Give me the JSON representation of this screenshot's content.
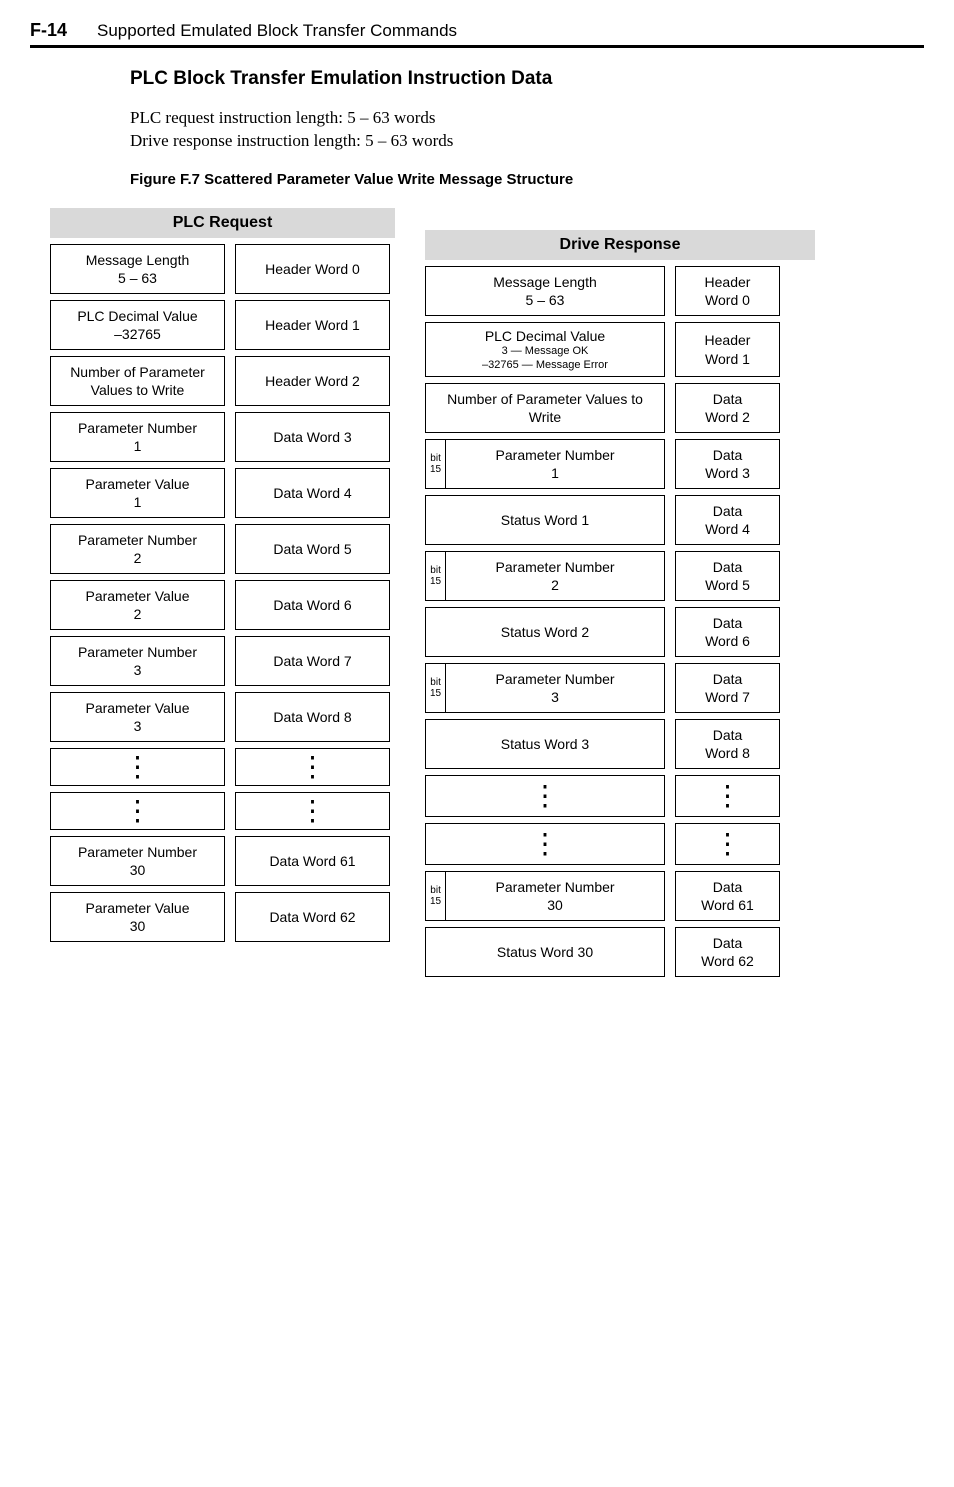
{
  "page": {
    "number": "F-14",
    "header": "Supported Emulated Block Transfer Commands"
  },
  "section_title": "PLC Block Transfer Emulation Instruction Data",
  "body1": "PLC request instruction length: 5 – 63 words",
  "body2": "Drive response instruction length: 5 – 63 words",
  "figure_label": "Figure F.7   Scattered Parameter Value Write Message Structure",
  "plc_request": {
    "title": "PLC Request",
    "left": [
      "Message Length\n5 – 63",
      "PLC Decimal Value\n–32765",
      "Number of Parameter Values to Write",
      "Parameter Number\n1",
      "Parameter Value\n1",
      "Parameter Number\n2",
      "Parameter Value\n2",
      "Parameter Number\n3",
      "Parameter Value\n3",
      "⋮",
      "⋮",
      "Parameter Number\n30",
      "Parameter Value\n30"
    ],
    "right": [
      "Header Word 0",
      "Header Word 1",
      "Header Word 2",
      "Data Word 3",
      "Data Word 4",
      "Data Word 5",
      "Data Word 6",
      "Data Word 7",
      "Data Word 8",
      "⋮",
      "⋮",
      "Data Word 61",
      "Data Word 62"
    ]
  },
  "drive_response": {
    "title": "Drive Response",
    "bit_label_top": "bit",
    "bit_label_bot": "15",
    "left": [
      {
        "text": "Message Length\n5 – 63"
      },
      {
        "text": "PLC Decimal Value",
        "sub": "3 — Message OK\n–32765 — Message Error"
      },
      {
        "text": "Number of Parameter Values to Write"
      },
      {
        "bit": true,
        "text": "Parameter Number\n1"
      },
      {
        "text": "Status Word 1"
      },
      {
        "bit": true,
        "text": "Parameter Number\n2"
      },
      {
        "text": "Status Word 2"
      },
      {
        "bit": true,
        "text": "Parameter Number\n3"
      },
      {
        "text": "Status Word 3"
      },
      {
        "text": "⋮"
      },
      {
        "text": "⋮"
      },
      {
        "bit": true,
        "text": "Parameter Number\n30"
      },
      {
        "text": "Status Word 30"
      }
    ],
    "right": [
      "Header\nWord 0",
      "Header\nWord 1",
      "Data\nWord 2",
      "Data\nWord 3",
      "Data\nWord 4",
      "Data\nWord 5",
      "Data\nWord 6",
      "Data\nWord 7",
      "Data\nWord 8",
      "⋮",
      "⋮",
      "Data\nWord 61",
      "Data\nWord 62"
    ]
  }
}
